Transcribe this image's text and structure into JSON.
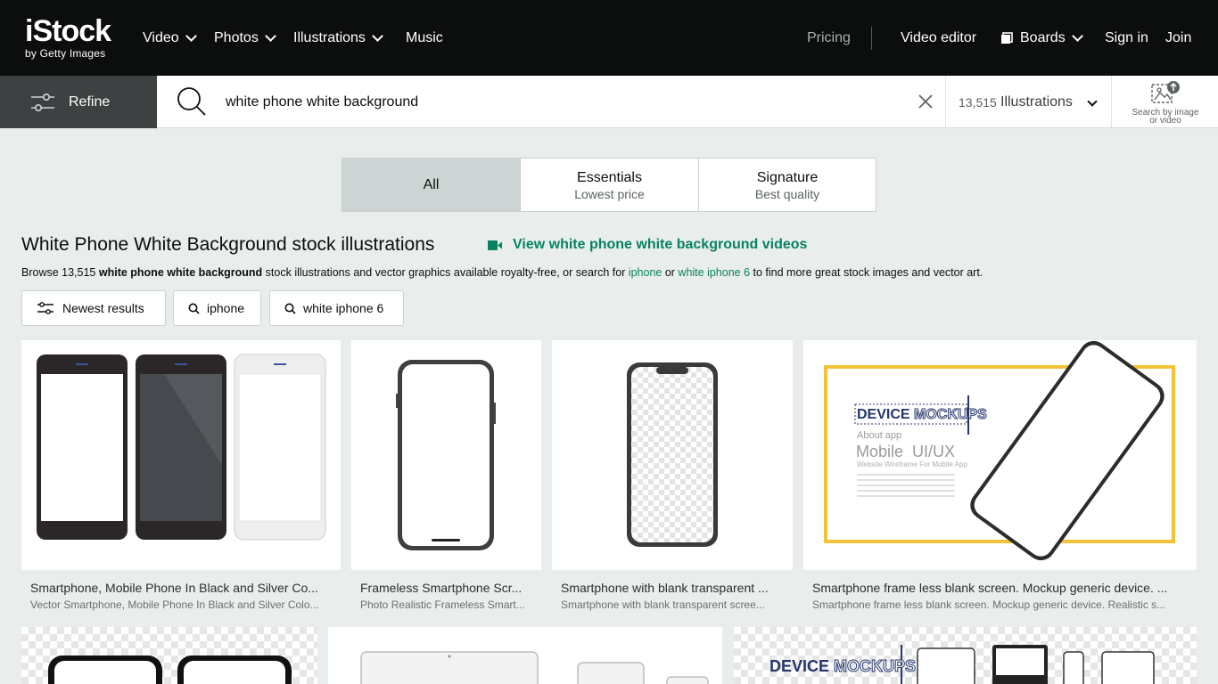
{
  "brand": {
    "name": "iStock",
    "tagline": "by Getty Images"
  },
  "nav": {
    "left": [
      {
        "label": "Video",
        "has_menu": true
      },
      {
        "label": "Photos",
        "has_menu": true
      },
      {
        "label": "Illustrations",
        "has_menu": true
      },
      {
        "label": "Music",
        "has_menu": false
      }
    ],
    "pricing": "Pricing",
    "video_editor": "Video editor",
    "boards": "Boards",
    "sign_in": "Sign in",
    "join": "Join"
  },
  "search": {
    "refine_label": "Refine",
    "query": "white phone white background",
    "result_count": "13,515",
    "media_type": "Illustrations",
    "image_search_label_1": "Search by image",
    "image_search_label_2": "or video"
  },
  "tabs": [
    {
      "title": "All",
      "subtitle": "",
      "active": true
    },
    {
      "title": "Essentials",
      "subtitle": "Lowest price",
      "active": false
    },
    {
      "title": "Signature",
      "subtitle": "Best quality",
      "active": false
    }
  ],
  "heading": {
    "title": "White Phone White Background stock illustrations",
    "videos_link": "View white phone white background videos",
    "browse_prefix": "Browse 13,515 ",
    "browse_query": "white phone white background",
    "browse_middle": " stock illustrations and vector graphics available royalty-free, or search for ",
    "browse_link1": "iphone",
    "browse_or": " or ",
    "browse_link2": "white iphone 6",
    "browse_suffix": " to find more great stock images and vector art."
  },
  "filters": [
    {
      "label": "Newest results",
      "icon": "sliders-icon"
    },
    {
      "label": "iphone",
      "icon": "search-icon"
    },
    {
      "label": "white iphone 6",
      "icon": "search-icon"
    }
  ],
  "results": [
    {
      "title": "Smartphone, Mobile Phone In Black and Silver Co...",
      "subtitle": "Vector Smartphone, Mobile Phone In Black and Silver Colo..."
    },
    {
      "title": "Frameless Smartphone Scr...",
      "subtitle": "Photo Realistic Frameless Smart..."
    },
    {
      "title": "Smartphone with blank transparent ...",
      "subtitle": "Smartphone with blank transparent scree..."
    },
    {
      "title": "Smartphone frame less blank screen. Mockup generic device. ...",
      "subtitle": "Smartphone frame less blank screen. Mockup generic device. Realistic s..."
    }
  ],
  "mockup_card": {
    "title_1": "DEVICE",
    "title_2": "MOCKUPS",
    "about": "About app",
    "subtitle": "Mobile  UI/UX",
    "tagline": "Website Wireframe For Mobile App"
  },
  "colors": {
    "accent": "#08835f",
    "nav_bg": "#0c0d0d",
    "page_bg": "#e9eeed",
    "frame_yellow": "#f2c33a"
  }
}
